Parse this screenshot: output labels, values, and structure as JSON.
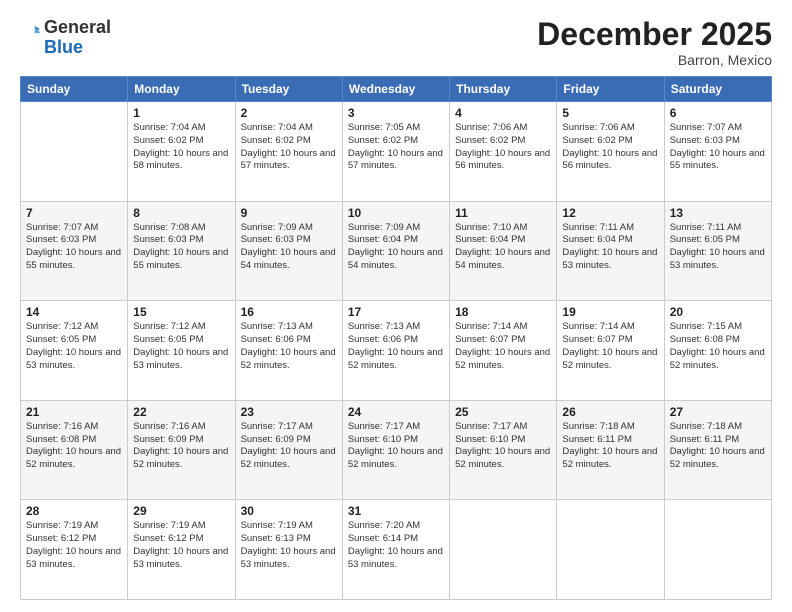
{
  "header": {
    "logo_general": "General",
    "logo_blue": "Blue",
    "month": "December 2025",
    "location": "Barron, Mexico"
  },
  "days_of_week": [
    "Sunday",
    "Monday",
    "Tuesday",
    "Wednesday",
    "Thursday",
    "Friday",
    "Saturday"
  ],
  "weeks": [
    [
      {
        "day": "",
        "info": ""
      },
      {
        "day": "1",
        "info": "Sunrise: 7:04 AM\nSunset: 6:02 PM\nDaylight: 10 hours\nand 58 minutes."
      },
      {
        "day": "2",
        "info": "Sunrise: 7:04 AM\nSunset: 6:02 PM\nDaylight: 10 hours\nand 57 minutes."
      },
      {
        "day": "3",
        "info": "Sunrise: 7:05 AM\nSunset: 6:02 PM\nDaylight: 10 hours\nand 57 minutes."
      },
      {
        "day": "4",
        "info": "Sunrise: 7:06 AM\nSunset: 6:02 PM\nDaylight: 10 hours\nand 56 minutes."
      },
      {
        "day": "5",
        "info": "Sunrise: 7:06 AM\nSunset: 6:02 PM\nDaylight: 10 hours\nand 56 minutes."
      },
      {
        "day": "6",
        "info": "Sunrise: 7:07 AM\nSunset: 6:03 PM\nDaylight: 10 hours\nand 55 minutes."
      }
    ],
    [
      {
        "day": "7",
        "info": "Sunrise: 7:07 AM\nSunset: 6:03 PM\nDaylight: 10 hours\nand 55 minutes."
      },
      {
        "day": "8",
        "info": "Sunrise: 7:08 AM\nSunset: 6:03 PM\nDaylight: 10 hours\nand 55 minutes."
      },
      {
        "day": "9",
        "info": "Sunrise: 7:09 AM\nSunset: 6:03 PM\nDaylight: 10 hours\nand 54 minutes."
      },
      {
        "day": "10",
        "info": "Sunrise: 7:09 AM\nSunset: 6:04 PM\nDaylight: 10 hours\nand 54 minutes."
      },
      {
        "day": "11",
        "info": "Sunrise: 7:10 AM\nSunset: 6:04 PM\nDaylight: 10 hours\nand 54 minutes."
      },
      {
        "day": "12",
        "info": "Sunrise: 7:11 AM\nSunset: 6:04 PM\nDaylight: 10 hours\nand 53 minutes."
      },
      {
        "day": "13",
        "info": "Sunrise: 7:11 AM\nSunset: 6:05 PM\nDaylight: 10 hours\nand 53 minutes."
      }
    ],
    [
      {
        "day": "14",
        "info": "Sunrise: 7:12 AM\nSunset: 6:05 PM\nDaylight: 10 hours\nand 53 minutes."
      },
      {
        "day": "15",
        "info": "Sunrise: 7:12 AM\nSunset: 6:05 PM\nDaylight: 10 hours\nand 53 minutes."
      },
      {
        "day": "16",
        "info": "Sunrise: 7:13 AM\nSunset: 6:06 PM\nDaylight: 10 hours\nand 52 minutes."
      },
      {
        "day": "17",
        "info": "Sunrise: 7:13 AM\nSunset: 6:06 PM\nDaylight: 10 hours\nand 52 minutes."
      },
      {
        "day": "18",
        "info": "Sunrise: 7:14 AM\nSunset: 6:07 PM\nDaylight: 10 hours\nand 52 minutes."
      },
      {
        "day": "19",
        "info": "Sunrise: 7:14 AM\nSunset: 6:07 PM\nDaylight: 10 hours\nand 52 minutes."
      },
      {
        "day": "20",
        "info": "Sunrise: 7:15 AM\nSunset: 6:08 PM\nDaylight: 10 hours\nand 52 minutes."
      }
    ],
    [
      {
        "day": "21",
        "info": "Sunrise: 7:16 AM\nSunset: 6:08 PM\nDaylight: 10 hours\nand 52 minutes."
      },
      {
        "day": "22",
        "info": "Sunrise: 7:16 AM\nSunset: 6:09 PM\nDaylight: 10 hours\nand 52 minutes."
      },
      {
        "day": "23",
        "info": "Sunrise: 7:17 AM\nSunset: 6:09 PM\nDaylight: 10 hours\nand 52 minutes."
      },
      {
        "day": "24",
        "info": "Sunrise: 7:17 AM\nSunset: 6:10 PM\nDaylight: 10 hours\nand 52 minutes."
      },
      {
        "day": "25",
        "info": "Sunrise: 7:17 AM\nSunset: 6:10 PM\nDaylight: 10 hours\nand 52 minutes."
      },
      {
        "day": "26",
        "info": "Sunrise: 7:18 AM\nSunset: 6:11 PM\nDaylight: 10 hours\nand 52 minutes."
      },
      {
        "day": "27",
        "info": "Sunrise: 7:18 AM\nSunset: 6:11 PM\nDaylight: 10 hours\nand 52 minutes."
      }
    ],
    [
      {
        "day": "28",
        "info": "Sunrise: 7:19 AM\nSunset: 6:12 PM\nDaylight: 10 hours\nand 53 minutes."
      },
      {
        "day": "29",
        "info": "Sunrise: 7:19 AM\nSunset: 6:12 PM\nDaylight: 10 hours\nand 53 minutes."
      },
      {
        "day": "30",
        "info": "Sunrise: 7:19 AM\nSunset: 6:13 PM\nDaylight: 10 hours\nand 53 minutes."
      },
      {
        "day": "31",
        "info": "Sunrise: 7:20 AM\nSunset: 6:14 PM\nDaylight: 10 hours\nand 53 minutes."
      },
      {
        "day": "",
        "info": ""
      },
      {
        "day": "",
        "info": ""
      },
      {
        "day": "",
        "info": ""
      }
    ]
  ]
}
